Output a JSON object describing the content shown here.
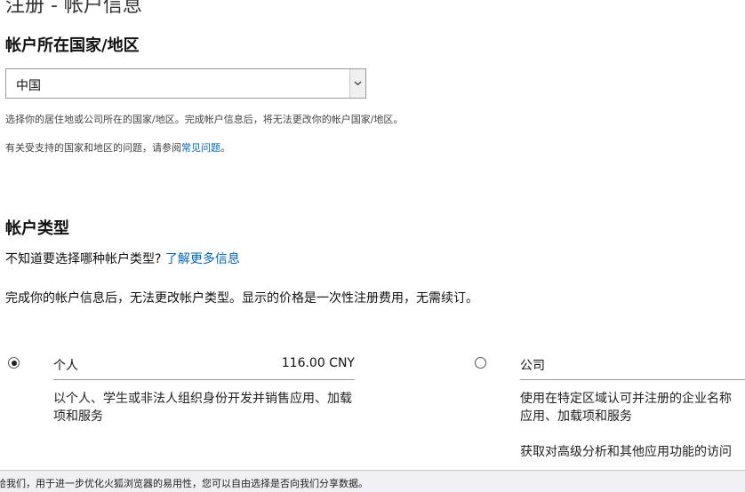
{
  "page": {
    "title": "注册 - 帐户信息"
  },
  "country_section": {
    "heading": "帐户所在国家/地区",
    "selected_country": "中国",
    "note1": "选择你的居住地或公司所在的国家/地区。完成帐户信息后，将无法更改你的帐户国家/地区。",
    "note2_prefix": "有关受支持的国家和地区的问题，请参阅",
    "note2_link": "常见问题",
    "note2_suffix": "。"
  },
  "account_type_section": {
    "heading": "帐户类型",
    "question": "不知道要选择哪种帐户类型?",
    "learn_more_link": "了解更多信息",
    "notice": "完成你的帐户信息后，无法更改帐户类型。显示的价格是一次性注册费用，无需续订。",
    "options": [
      {
        "label": "个人",
        "price": "116.00 CNY",
        "selected": true,
        "description": "以个人、学生或非法人组织身份开发并销售应用、加载项和服务"
      },
      {
        "label": "公司",
        "price": "",
        "selected": false,
        "description_line1": "使用在特定区域认可并注册的企业名称",
        "description_line2": "应用、加载项和服务",
        "description_line3": "获取对高级分析和其他应用功能的访问"
      }
    ]
  },
  "notification_bar": {
    "text": "给我们，用于进一步优化火狐浏览器的易用性，您可以自由选择是否向我们分享数据。"
  }
}
